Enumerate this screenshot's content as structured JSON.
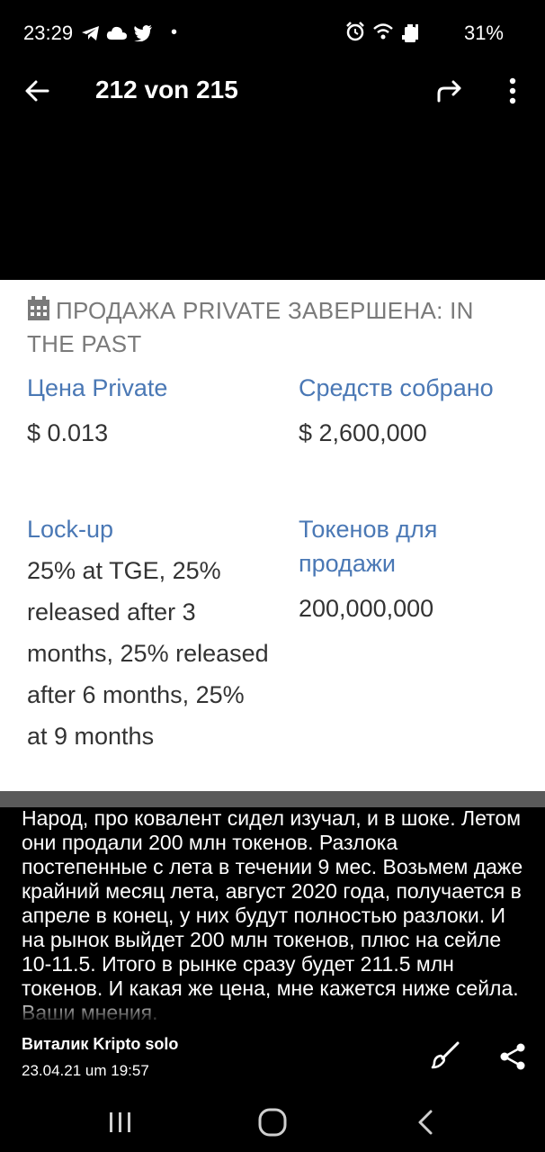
{
  "status_bar": {
    "time": "23:29",
    "dot": "•",
    "battery_percent": "31%",
    "left_icons": [
      "telegram-icon",
      "cloud-icon",
      "twitter-icon"
    ],
    "right_icons": [
      "alarm-icon",
      "wifi-icon",
      "signal-icon",
      "battery-icon"
    ]
  },
  "app_bar": {
    "title": "212 von 215",
    "icons": [
      "back-arrow-icon",
      "share-forward-icon",
      "more-vert-icon"
    ]
  },
  "card": {
    "section_head": "ПРОДАЖА PRIVATE ЗАВЕРШЕНА: IN THE PAST",
    "fields": [
      {
        "label": "Цена Private",
        "value": "$ 0.013"
      },
      {
        "label": "Средств собрано",
        "value": "$ 2,600,000"
      },
      {
        "label": "Lock-up",
        "value": "25% at TGE, 25% released after 3 months, 25% released after 6 months, 25% at 9 months"
      },
      {
        "label": "Токенов для продажи",
        "value": "200,000,000"
      }
    ],
    "colors": {
      "label": "#4a78b5",
      "value": "#333333",
      "head": "#7a7a7a"
    }
  },
  "caption": "Народ, про ковалент сидел изучал, и в шоке. Летом они продали 200 млн токенов. Разлока постепенные с лета в течении 9 мес. Возьмем даже крайний месяц лета, август 2020 года, получается в апреле в конец, у них будут полностью разлоки. И на рынок выйдет 200 млн токенов, плюс на сейле 10-11.5. Итого в рынке сразу будет 211.5 млн токенов. И какая же цена, мне кажется ниже сейла. Ваши мнения.",
  "footer": {
    "author": "Виталик Kripto solo",
    "date": "23.04.21 um 19:57",
    "icons": [
      "brush-icon",
      "share-icon"
    ]
  },
  "nav": {
    "icons": [
      "recent-apps-icon",
      "home-icon",
      "nav-back-icon"
    ]
  }
}
